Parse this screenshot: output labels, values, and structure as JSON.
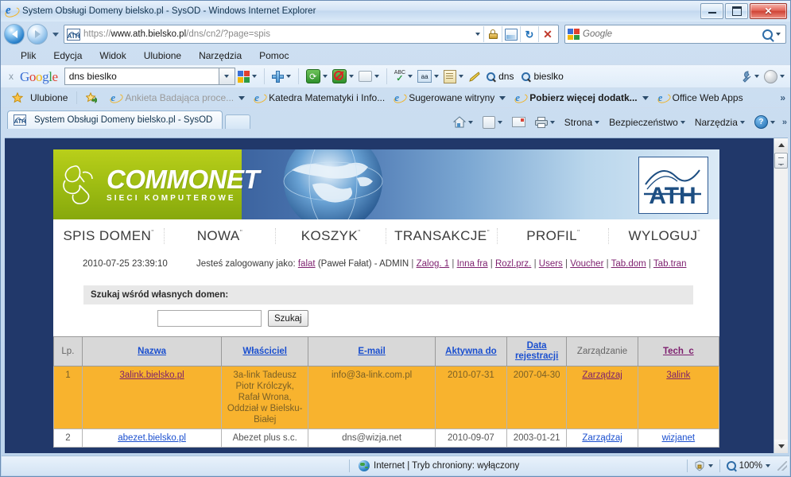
{
  "window": {
    "title": "System Obsługi Domeny bielsko.pl - SysOD - Windows Internet Explorer",
    "minimize_label": "Minimalizuj",
    "maximize_label": "Maksymalizuj",
    "close_label": "Zamknij"
  },
  "address_bar": {
    "url_protocol": "https://",
    "url_host": "www.ath.bielsko.pl",
    "url_path": "/dns/cn2/?page=spis",
    "full_url": "https://www.ath.bielsko.pl/dns/cn2/?page=spis"
  },
  "search_bar": {
    "placeholder": "Google"
  },
  "menu": {
    "items": [
      "Plik",
      "Edycja",
      "Widok",
      "Ulubione",
      "Narzędzia",
      "Pomoc"
    ]
  },
  "google_toolbar": {
    "close_label": "x",
    "brand": "Google",
    "query": "dns bieslko",
    "quick_links": [
      "dns",
      "bieslko"
    ]
  },
  "favorites_bar": {
    "label": "Ulubione",
    "items": [
      {
        "label": "Ankieta Badająca proce...",
        "dropdown": true,
        "dim": true
      },
      {
        "label": "Katedra Matematyki i Info...",
        "dropdown": false,
        "dim": false
      },
      {
        "label": "Sugerowane witryny",
        "dropdown": true,
        "dim": false
      },
      {
        "label": "Pobierz więcej dodatk...",
        "dropdown": true,
        "dim": false
      },
      {
        "label": "Office Web Apps",
        "dropdown": false,
        "dim": false
      }
    ],
    "overflow": "»"
  },
  "tabs": {
    "active": "System Obsługi Domeny bielsko.pl - SysOD",
    "new_tab_label": ""
  },
  "command_bar": {
    "items": [
      "Strona",
      "Bezpieczeństwo",
      "Narzędzia"
    ],
    "overflow": "»"
  },
  "page": {
    "logo": {
      "name": "COMMONET",
      "subtitle": "SIECI KOMPUTEROWE",
      "ath_label": "ATH"
    },
    "nav": [
      {
        "label": "SPIS DOMEN",
        "sup": "\""
      },
      {
        "label": "NOWA",
        "sup": "\""
      },
      {
        "label": "KOSZYK",
        "sup": "\""
      },
      {
        "label": "TRANSAKCJE",
        "sup": "\""
      },
      {
        "label": "PROFIL",
        "sup": "\""
      },
      {
        "label": "WYLOGUJ",
        "sup": "\""
      }
    ],
    "info": {
      "datetime": "2010-07-25 23:39:10",
      "logged_prefix": "Jesteś zalogowany jako:",
      "user_login": "falat",
      "user_name": "(Paweł Fałat) - ADMIN",
      "links": [
        "Zalog. 1",
        "Inna fra",
        "Rozl.prz.",
        "Users",
        "Voucher",
        "Tab.dom",
        "Tab.tran"
      ]
    },
    "search": {
      "panel_label": "Szukaj wśród własnych domen:",
      "input_value": "",
      "button_label": "Szukaj"
    },
    "table": {
      "headers": [
        {
          "label": "Lp.",
          "link": false,
          "style": "plain"
        },
        {
          "label": "Nazwa",
          "link": true,
          "style": "blue"
        },
        {
          "label": "Właściciel",
          "link": true,
          "style": "blue"
        },
        {
          "label": "E-mail",
          "link": true,
          "style": "blue"
        },
        {
          "label": "Aktywna do",
          "link": true,
          "style": "blue"
        },
        {
          "label": "Data rejestracji",
          "link": true,
          "style": "blue"
        },
        {
          "label": "Zarządzanie",
          "link": false,
          "style": "plain"
        },
        {
          "label": "Tech_c",
          "link": true,
          "style": "purple"
        }
      ],
      "rows": [
        {
          "highlight": true,
          "lp": "1",
          "nazwa": "3alink.bielsko.pl",
          "wlasciciel": "3a-link Tadeusz Piotr Królczyk, Rafał Wrona, Oddział w Bielsku-Białej",
          "email": "info@3a-link.com.pl",
          "aktywna_do": "2010-07-31",
          "data_rejestracji": "2007-04-30",
          "zarzadzanie": "Zarządzaj",
          "tech_c": "3alink"
        },
        {
          "highlight": false,
          "lp": "2",
          "nazwa": "abezet.bielsko.pl",
          "wlasciciel": "Abezet plus s.c.",
          "email": "dns@wizja.net",
          "aktywna_do": "2010-09-07",
          "data_rejestracji": "2003-01-21",
          "zarzadzanie": "Zarządzaj",
          "tech_c": "wizjanet"
        }
      ]
    }
  },
  "status_bar": {
    "zone_text": "Internet | Tryb chroniony: wyłączony",
    "zoom": "100%"
  },
  "colors": {
    "accent_green": "#9cbb12",
    "highlight_row": "#f8b32e",
    "link_blue": "#1a4fcf",
    "link_purple": "#7d1f6e",
    "banner_blue": "#2a4c86"
  }
}
